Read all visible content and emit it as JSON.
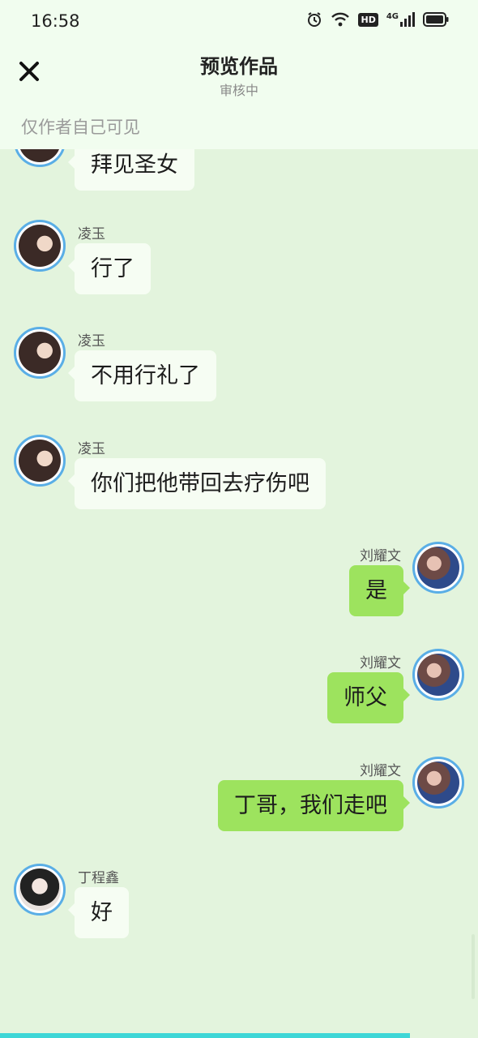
{
  "status_bar": {
    "time": "16:58",
    "hd_label": "HD",
    "network_label": "4G"
  },
  "header": {
    "title": "预览作品",
    "subtitle": "审核中",
    "visibility_note": "仅作者自己可见"
  },
  "messages": [
    {
      "side": "left",
      "sender": "",
      "text": "拜见圣女"
    },
    {
      "side": "left",
      "sender": "凌玉",
      "text": "行了"
    },
    {
      "side": "left",
      "sender": "凌玉",
      "text": "不用行礼了"
    },
    {
      "side": "left",
      "sender": "凌玉",
      "text": "你们把他带回去疗伤吧"
    },
    {
      "side": "right",
      "sender": "刘耀文",
      "text": "是"
    },
    {
      "side": "right",
      "sender": "刘耀文",
      "text": "师父"
    },
    {
      "side": "right",
      "sender": "刘耀文",
      "text": "丁哥，我们走吧"
    },
    {
      "side": "left",
      "sender": "丁程鑫",
      "text": "好"
    }
  ],
  "colors": {
    "background": "#e3f4dd",
    "header_bg": "#f1fdef",
    "left_bubble": "#f6fdf3",
    "right_bubble": "#9de35e",
    "avatar_ring": "#5aaee6"
  }
}
